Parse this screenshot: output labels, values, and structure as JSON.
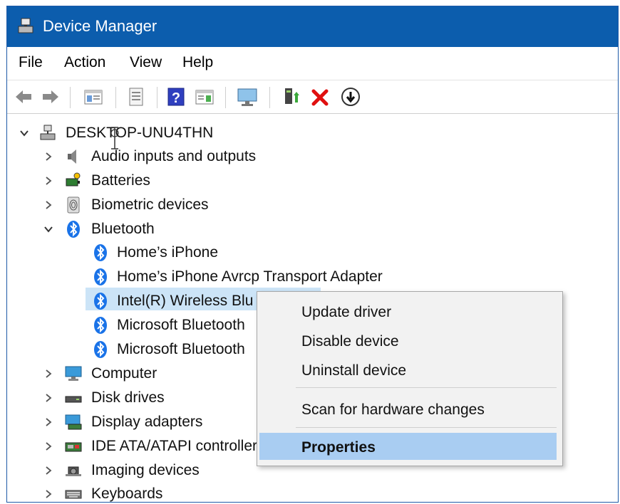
{
  "window": {
    "title": "Device Manager"
  },
  "menu": [
    "File",
    "Action",
    "View",
    "Help"
  ],
  "tree": {
    "root": "DESKTOP-UNU4THN",
    "items": [
      {
        "label": "Audio inputs and outputs"
      },
      {
        "label": "Batteries"
      },
      {
        "label": "Biometric devices"
      },
      {
        "label": "Bluetooth"
      },
      {
        "label": "Home’s iPhone"
      },
      {
        "label": "Home’s iPhone Avrcp Transport Adapter"
      },
      {
        "label": "Intel(R) Wireless Blu"
      },
      {
        "label": "Microsoft Bluetooth"
      },
      {
        "label": "Microsoft Bluetooth"
      },
      {
        "label": "Computer"
      },
      {
        "label": "Disk drives"
      },
      {
        "label": "Display adapters"
      },
      {
        "label": "IDE ATA/ATAPI controller"
      },
      {
        "label": "Imaging devices"
      },
      {
        "label": "Keyboards"
      }
    ]
  },
  "context_menu": {
    "items": [
      "Update driver",
      "Disable device",
      "Uninstall device",
      "Scan for hardware changes",
      "Properties"
    ]
  },
  "colors": {
    "titlebar": "#0c5dad",
    "selection": "#cce4f7",
    "menu_highlight": "#a9cdf2",
    "bluetooth": "#1a73e8"
  }
}
